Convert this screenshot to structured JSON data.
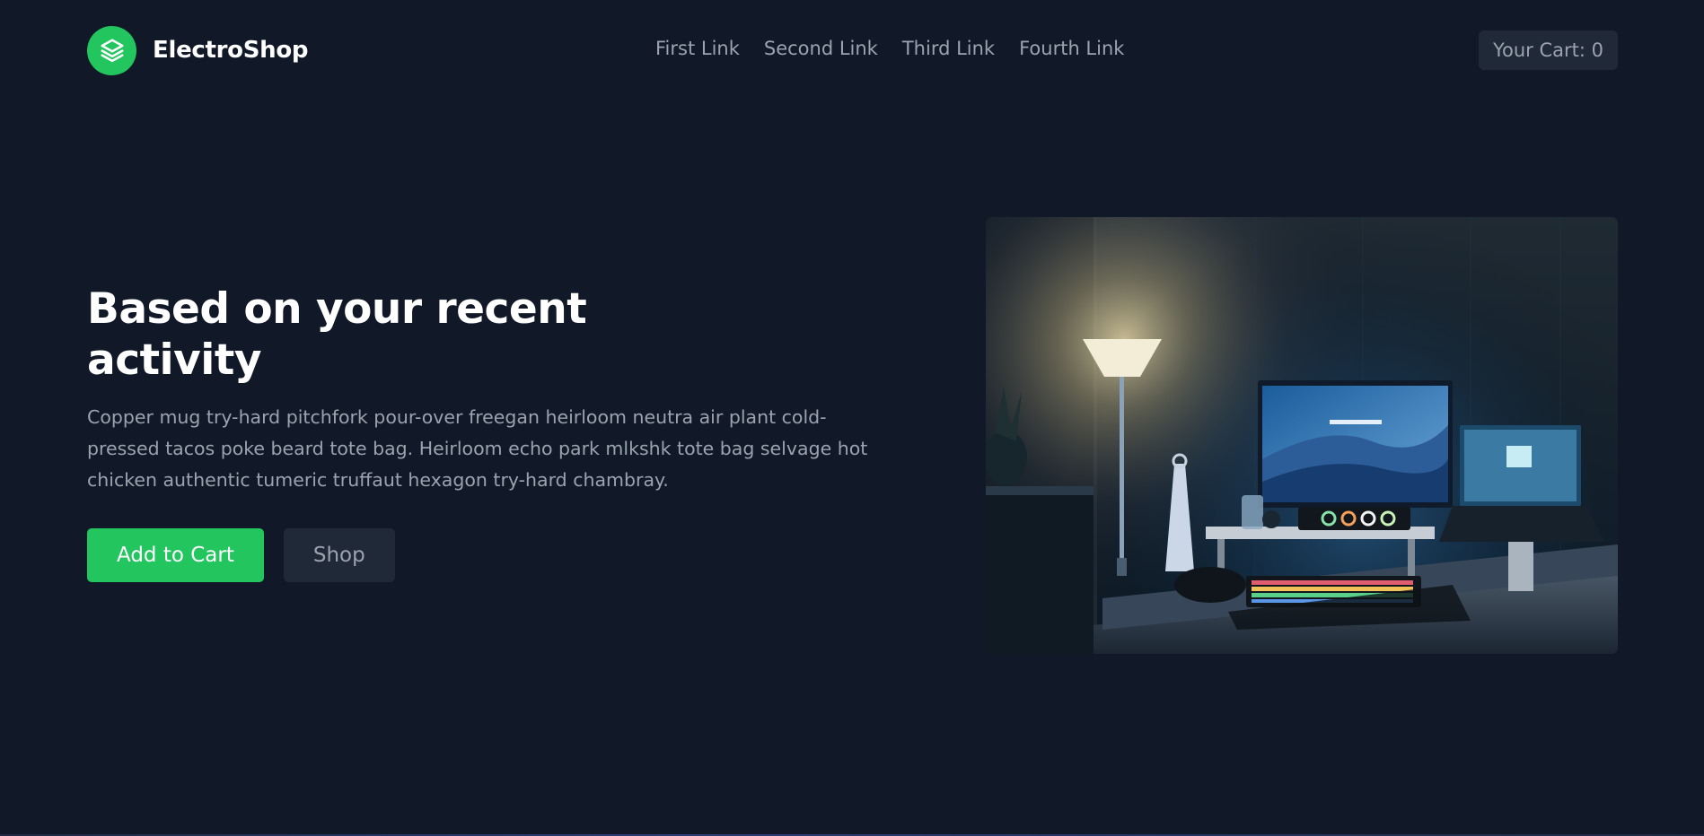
{
  "brand": {
    "name": "ElectroShop",
    "logo_icon": "stack-layers-icon",
    "accent": "#22c55e"
  },
  "nav": {
    "links": [
      {
        "label": "First Link"
      },
      {
        "label": "Second Link"
      },
      {
        "label": "Third Link"
      },
      {
        "label": "Fourth Link"
      }
    ]
  },
  "cart": {
    "label": "Your Cart: 0"
  },
  "hero": {
    "title": "Based on your recent activity",
    "description": "Copper mug try-hard pitchfork pour-over freegan heirloom neutra air plant cold-pressed tacos poke beard tote bag. Heirloom echo park mlkshk tote bag selvage hot chicken authentic tumeric truffaut hexagon try-hard chambray.",
    "primary_button": "Add to Cart",
    "secondary_button": "Shop"
  },
  "colors": {
    "background": "#111827",
    "surface": "#1f2937",
    "muted_text": "#9ca3af",
    "accent": "#22c55e"
  }
}
